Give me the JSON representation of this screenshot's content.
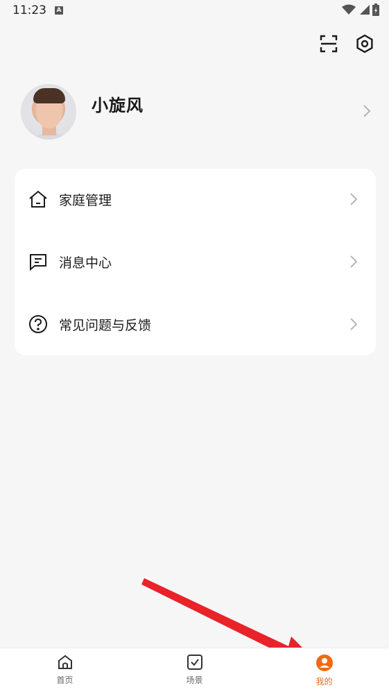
{
  "status_bar": {
    "time": "11:23",
    "notification_badge": "A"
  },
  "profile": {
    "name": "小旋风"
  },
  "menu": [
    {
      "label": "家庭管理",
      "icon": "home-icon"
    },
    {
      "label": "消息中心",
      "icon": "message-icon"
    },
    {
      "label": "常见问题与反馈",
      "icon": "help-icon"
    }
  ],
  "bottom_nav": [
    {
      "label": "首页",
      "icon": "home-icon",
      "active": false
    },
    {
      "label": "场景",
      "icon": "scene-check-icon",
      "active": false
    },
    {
      "label": "我的",
      "icon": "profile-icon",
      "active": true
    }
  ],
  "colors": {
    "accent": "#f06a14",
    "arrow": "#e8232a",
    "background": "#f6f6f7"
  }
}
